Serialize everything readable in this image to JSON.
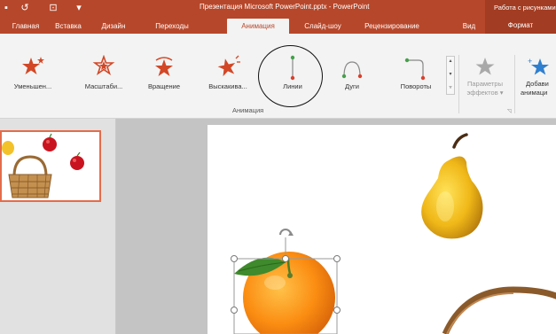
{
  "window": {
    "title": "Презентация Microsoft PowerPoint.pptx - PowerPoint",
    "context_title": "Работа с рисунками"
  },
  "qat": [
    {
      "icon": "save-icon",
      "glyph": "▪"
    },
    {
      "icon": "undo-icon",
      "glyph": "↺"
    },
    {
      "icon": "start-presentation-icon",
      "glyph": "⊡"
    },
    {
      "icon": "customize-qat-icon",
      "glyph": "▾"
    }
  ],
  "tabs": [
    {
      "id": "home",
      "label": "Главная"
    },
    {
      "id": "insert",
      "label": "Вставка"
    },
    {
      "id": "design",
      "label": "Дизайн"
    },
    {
      "id": "transitions",
      "label": "Переходы"
    },
    {
      "id": "animations",
      "label": "Анимация"
    },
    {
      "id": "slideshow",
      "label": "Слайд-шоу"
    },
    {
      "id": "review",
      "label": "Рецензирование"
    },
    {
      "id": "view",
      "label": "Вид"
    },
    {
      "id": "format",
      "label": "Формат"
    }
  ],
  "active_tab": "animations",
  "ribbon": {
    "gallery": [
      {
        "id": "shrink",
        "label": "Уменьшен...",
        "icon": "shrink-effect-icon"
      },
      {
        "id": "grow",
        "label": "Масштаби...",
        "icon": "grow-turn-effect-icon"
      },
      {
        "id": "spin",
        "label": "Вращение",
        "icon": "spin-effect-icon"
      },
      {
        "id": "popout",
        "label": "Выскакива...",
        "icon": "pop-effect-icon"
      },
      {
        "id": "lines",
        "label": "Линии",
        "icon": "lines-path-icon"
      },
      {
        "id": "arcs",
        "label": "Дуги",
        "icon": "arcs-path-icon"
      },
      {
        "id": "turns",
        "label": "Повороты",
        "icon": "turns-path-icon"
      }
    ],
    "effect_options": {
      "line1": "Параметры",
      "line2": "эффектов ▾"
    },
    "add_animation": {
      "line1": "Добави",
      "line2": "анимаци"
    },
    "group_label": "Анимация",
    "colors": {
      "accent": "#b7472a",
      "star": "#d24726",
      "path_green": "#45a04a",
      "path_red": "#d9402c"
    }
  }
}
